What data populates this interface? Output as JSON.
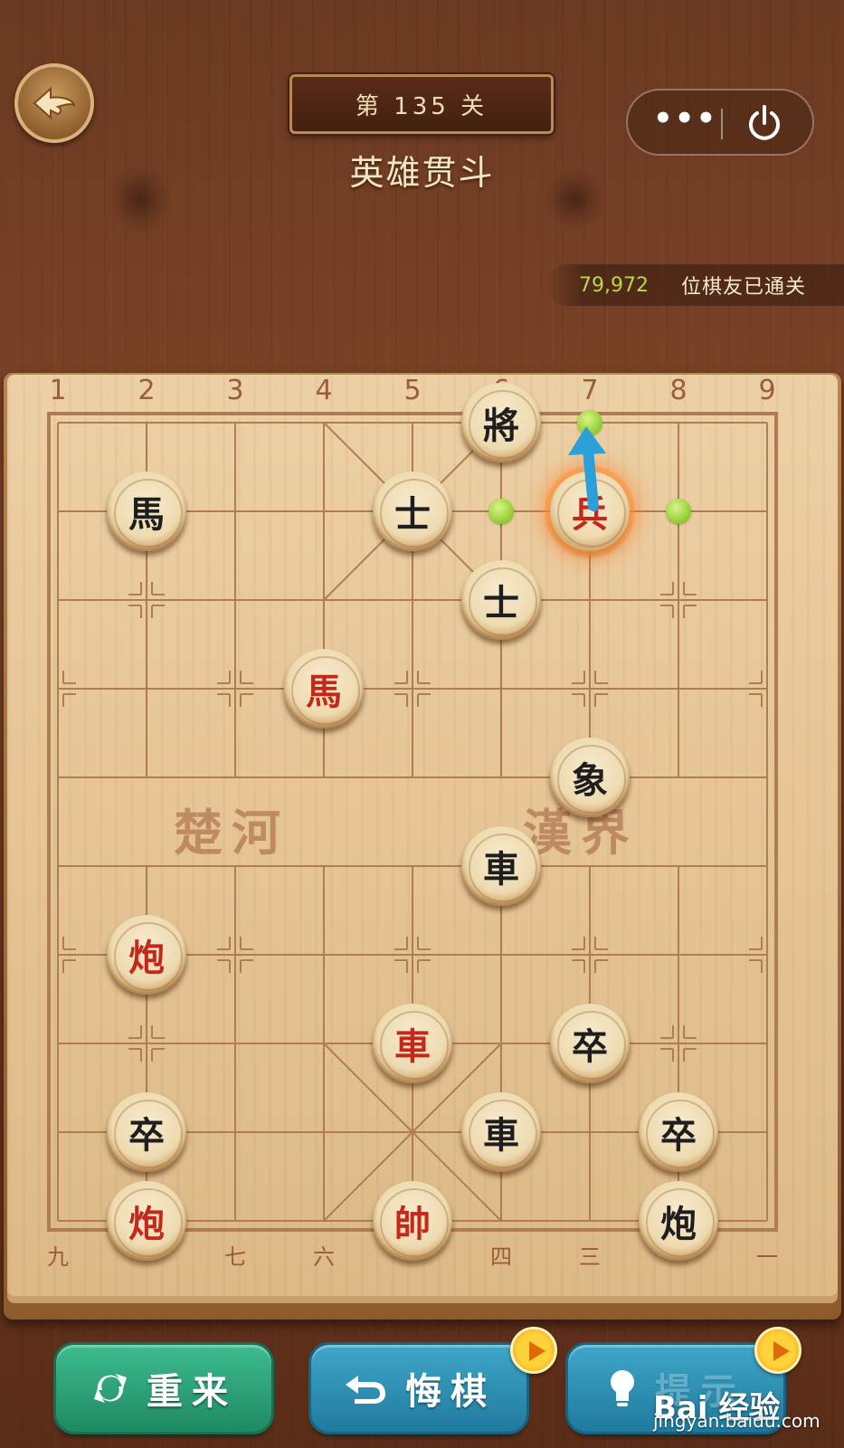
{
  "header": {
    "level_label": "第 135 关",
    "level_name": "英雄贯斗",
    "menu_dots": "•••",
    "passed_count": "79,972",
    "passed_text": "位棋友已通关"
  },
  "board": {
    "top_numbers": [
      "1",
      "2",
      "3",
      "4",
      "5",
      "6",
      "7",
      "8",
      "9"
    ],
    "bottom_numbers": [
      "九",
      "",
      "七",
      "六",
      "",
      "四",
      "三",
      "",
      "一"
    ],
    "river_left": "楚河",
    "river_right": "漢界",
    "pieces": [
      {
        "char": "將",
        "side": "black",
        "file": 5,
        "rank": 0
      },
      {
        "char": "馬",
        "side": "black",
        "file": 1,
        "rank": 1
      },
      {
        "char": "士",
        "side": "black",
        "file": 4,
        "rank": 1
      },
      {
        "char": "兵",
        "side": "red",
        "file": 6,
        "rank": 1,
        "selected": true
      },
      {
        "char": "士",
        "side": "black",
        "file": 5,
        "rank": 2
      },
      {
        "char": "馬",
        "side": "red",
        "file": 3,
        "rank": 3
      },
      {
        "char": "象",
        "side": "black",
        "file": 6,
        "rank": 4
      },
      {
        "char": "車",
        "side": "black",
        "file": 5,
        "rank": 5
      },
      {
        "char": "炮",
        "side": "red",
        "file": 1,
        "rank": 6
      },
      {
        "char": "車",
        "side": "red",
        "file": 4,
        "rank": 7
      },
      {
        "char": "卒",
        "side": "black",
        "file": 6,
        "rank": 7
      },
      {
        "char": "卒",
        "side": "black",
        "file": 1,
        "rank": 8
      },
      {
        "char": "車",
        "side": "black",
        "file": 5,
        "rank": 8
      },
      {
        "char": "卒",
        "side": "black",
        "file": 7,
        "rank": 8
      },
      {
        "char": "炮",
        "side": "red",
        "file": 1,
        "rank": 9
      },
      {
        "char": "帥",
        "side": "red",
        "file": 4,
        "rank": 9
      },
      {
        "char": "炮",
        "side": "black",
        "file": 7,
        "rank": 9
      }
    ],
    "hint_moves": [
      {
        "file": 6,
        "rank": 0
      },
      {
        "file": 5,
        "rank": 1
      },
      {
        "file": 7,
        "rank": 1
      }
    ],
    "colors": {
      "red_piece": "#c3291b",
      "black_piece": "#1e1e1e",
      "hint": "#8fcb2a",
      "arrow": "#2b9fd8"
    }
  },
  "buttons": {
    "restart": "重来",
    "undo": "悔棋",
    "hint": "提示"
  },
  "watermark": {
    "brand": "Bai 经验",
    "url": "jingyan.baidu.com"
  }
}
